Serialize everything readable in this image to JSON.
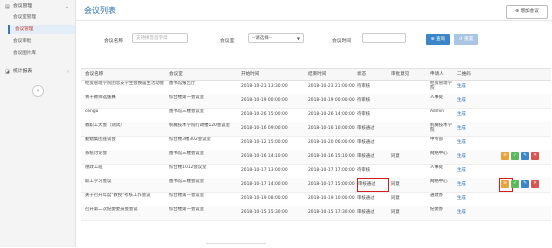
{
  "sidebar": {
    "group1": {
      "icon": "list-icon",
      "label": "会议管理"
    },
    "items": [
      {
        "label": "会议室管理",
        "active": false
      },
      {
        "label": "会议管理",
        "active": true
      },
      {
        "label": "会议审批",
        "active": false
      },
      {
        "label": "会议图片库",
        "active": false
      }
    ],
    "group2": {
      "icon": "chart-icon",
      "label": "统计报表"
    }
  },
  "header": {
    "title": "会议列表",
    "add_button": "⊕ 增加会议"
  },
  "filters": {
    "name_label": "会议名称",
    "name_placeholder": "支持拼音首字母",
    "room_label": "会议室",
    "room_selected": "--请选择--",
    "time_label": "会议时间",
    "search_button": "⊕ 查询",
    "reset_button": "↺ 重置"
  },
  "table": {
    "columns": [
      "会议名称",
      "会议室",
      "开始时间",
      "结束时间",
      "状态",
      "审批意见",
      "申请人",
      "二维码"
    ],
    "rows": [
      {
        "name": "经贸管理学院团总支学生会换届生活动会",
        "room": "图书馆报告厅",
        "start": "2018-10-23 13:30:00",
        "end": "2018-10-23 21:00:00",
        "status": "待审核",
        "opinion": "",
        "applicant": "经贸管理学院",
        "qr": "生成",
        "actions": false
      },
      {
        "name": "青干教师选拔赛",
        "room": "综合楼第一会议室",
        "start": "2018-10-19 00:00:00",
        "end": "2018-10-19 00:00:00",
        "status": "待审核",
        "opinion": "",
        "applicant": "人事处",
        "qr": "生成",
        "actions": false
      },
      {
        "name": "cengu",
        "room": "图书馆三楼会议室",
        "start": "2018-10-26 15:00:00",
        "end": "2018-10-26 14:00:00",
        "status": "待审核",
        "opinion": "",
        "applicant": "Admin",
        "qr": "生成",
        "actions": false
      },
      {
        "name": "教职工大会（测试）",
        "room": "机械技术学院行政楼120会议室",
        "start": "2018-10-16 09:00:00",
        "end": "2018-10-16 10:00:00",
        "status": "审核通过",
        "opinion": "",
        "applicant": "机械技术学院",
        "qr": "生成",
        "actions": false
      },
      {
        "name": "勤勉集团座谈会",
        "room": "综合楼3楼302会议室",
        "start": "2018-10-12 15:00:00",
        "end": "2018-10-20 06:00:00",
        "status": "审核通过",
        "opinion": "",
        "applicant": "中专部",
        "qr": "生成",
        "actions": false
      },
      {
        "name": "系统讨论会",
        "room": "图书馆三楼会议室",
        "start": "2018-10-16 14:10:00",
        "end": "2018-10-16 15:10:00",
        "status": "审核通过",
        "opinion": "同意",
        "applicant": "网络中心",
        "qr": "生成",
        "actions": true
      },
      {
        "name": "德政工班",
        "room": "综合楼1012会议室",
        "start": "2018-10-17 13:00:00",
        "end": "2018-10-17 17:00:00",
        "status": "待审核",
        "opinion": "",
        "applicant": "人事处",
        "qr": "生成",
        "actions": false
      },
      {
        "name": "职工学习会议",
        "room": "图书馆三楼会议室",
        "start": "2018-10-17 14:00:00",
        "end": "2018-10-17 15:00:00",
        "status": "审核通过",
        "opinion": "同意",
        "applicant": "网络中心",
        "qr": "生成",
        "actions": true,
        "highlight": true
      },
      {
        "name": "关于召开年度\"教授\"考核工作会议",
        "room": "综合楼第一会议室",
        "start": "2018-10-19 08:00:00",
        "end": "2018-10-19 10:00:00",
        "status": "审核通过",
        "opinion": "同意",
        "applicant": "通建办",
        "qr": "生成",
        "actions": false
      },
      {
        "name": "召开第二次纪委委员会会议",
        "room": "综合楼第一会议室",
        "start": "2018-10-15 15:30:00",
        "end": "2018-10-15 17:30:00",
        "status": "审核通过",
        "opinion": "同意",
        "applicant": "纪委办",
        "qr": "生成",
        "actions": false
      }
    ]
  },
  "colors": {
    "accent": "#2a6db0",
    "search": "#3a86c8",
    "highlight": "#d02020"
  }
}
